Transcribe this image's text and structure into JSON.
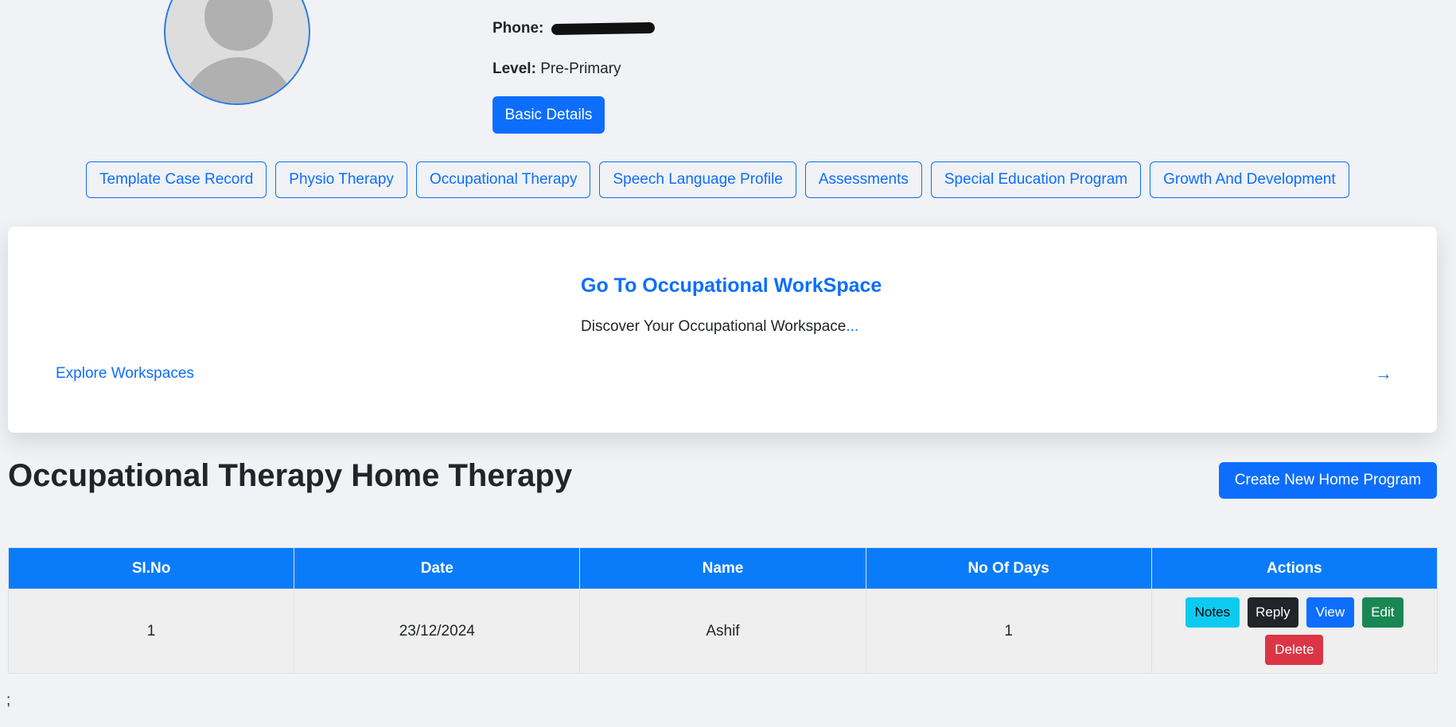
{
  "profile": {
    "phone_label": "Phone:",
    "level_label": "Level:",
    "level_value": "Pre-Primary",
    "basic_details_button": "Basic Details"
  },
  "tabs": [
    {
      "label": "Template Case Record"
    },
    {
      "label": "Physio Therapy"
    },
    {
      "label": "Occupational Therapy"
    },
    {
      "label": "Speech Language Profile"
    },
    {
      "label": "Assessments"
    },
    {
      "label": "Special Education Program"
    },
    {
      "label": "Growth And Development"
    }
  ],
  "workspace_card": {
    "title": "Go To Occupational WorkSpace",
    "description": "Discover Your Occupational Workspace",
    "ellipsis": "...",
    "link": "Explore Workspaces",
    "arrow": "→"
  },
  "section": {
    "title": "Occupational Therapy Home Therapy",
    "create_button": "Create New Home Program"
  },
  "table": {
    "headers": [
      "SI.No",
      "Date",
      "Name",
      "No Of Days",
      "Actions"
    ],
    "rows": [
      {
        "si_no": "1",
        "date": "23/12/2024",
        "name": "Ashif",
        "days": "1"
      }
    ],
    "actions": {
      "notes": "Notes",
      "reply": "Reply",
      "view": "View",
      "edit": "Edit",
      "delete": "Delete"
    }
  },
  "footer_text": ";",
  "colors": {
    "primary": "#0d6efd",
    "table_header": "#0a7cf9",
    "info": "#0dcaf0",
    "dark": "#212529",
    "success": "#198754",
    "danger": "#dc3545"
  }
}
